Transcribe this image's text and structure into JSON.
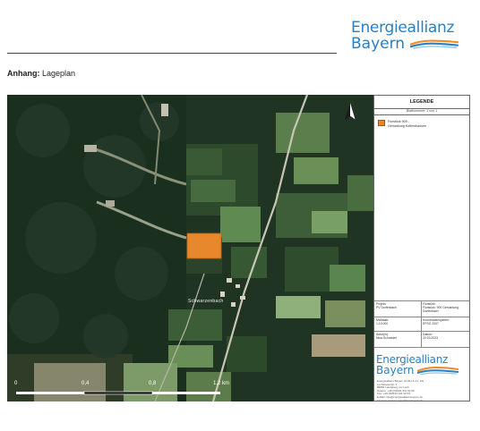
{
  "logo": {
    "line1": "Energieallianz",
    "line2": "Bayern"
  },
  "heading": {
    "label": "Anhang:",
    "text": "Lageplan"
  },
  "map": {
    "place_name": "Schwarzenbach",
    "scale": {
      "ticks": [
        "0",
        "0,4",
        "0,8",
        "1,2 km"
      ]
    },
    "colors": {
      "highlight_parcel": "#e8882c"
    }
  },
  "legend": {
    "title": "LEGENDE",
    "subtitle": "Blattnummer: 1 von 1",
    "item_text": [
      "Flurstück 909 -",
      "Gemarkung Kottershausen"
    ],
    "info": {
      "project_label": "Projekt:",
      "project_value": "PV Dorfenbach",
      "parcel_label": "Flurstück:",
      "parcel_value": "Flurstück: 909 Gemarkung Dorfenbach",
      "scale_label": "Maßstab:",
      "scale_value": "1:10.000",
      "crs_label": "Koordinatensystem:",
      "crs_value": "EPSG 2007",
      "author_label": "Autor(in):",
      "author_value": "Nina Schneider",
      "date_label": "Datum:",
      "date_value": "20.03.2023"
    },
    "logo": {
      "line1": "Energieallianz",
      "line2": "Bayern"
    },
    "footer": [
      "Energieallianz Bayern GmbH & Co. KG",
      "Lechwiesenstr. 7",
      "86899 Landsberg am Lech",
      "Telefon: +49 (0)8191 311 92 00",
      "Fax: +49 (0)8191 311 92 09",
      "E-Mail: info@energieallianz-bayern.de",
      "Internet: www.energieallianz-bayern.de"
    ]
  }
}
